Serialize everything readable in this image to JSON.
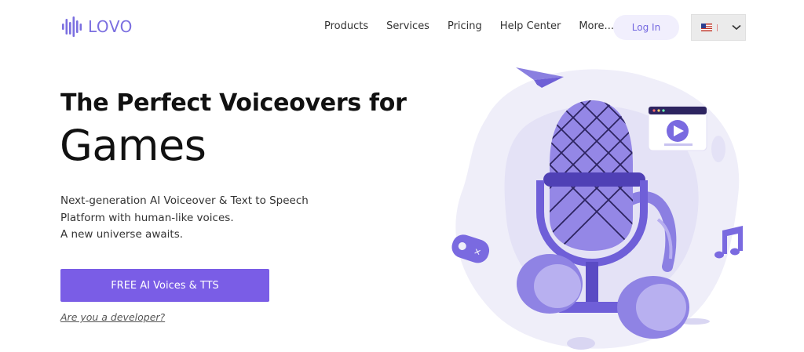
{
  "brand": {
    "name": "LOVO",
    "accent": "#7a5de6",
    "logo_color": "#7b6fe0"
  },
  "nav": {
    "items": [
      "Products",
      "Services",
      "Pricing",
      "Help Center",
      "More..."
    ]
  },
  "header": {
    "login_label": "Log In",
    "language": {
      "flag_icon": "us-flag-icon",
      "chevron_icon": "chevron-down-icon"
    }
  },
  "hero": {
    "title_line1": "The Perfect Voiceovers for",
    "title_line2": "Games",
    "description": [
      "Next-generation AI Voiceover & Text to Speech",
      "Platform with human-like voices.",
      "A new universe awaits."
    ],
    "cta_label": "FREE AI Voices & TTS",
    "developer_link": "Are you a developer?"
  },
  "illustration": {
    "icons": [
      "paper-plane-icon",
      "microphone-icon",
      "video-play-icon",
      "gamepad-icon",
      "music-note-icon",
      "headphones-icon"
    ]
  }
}
